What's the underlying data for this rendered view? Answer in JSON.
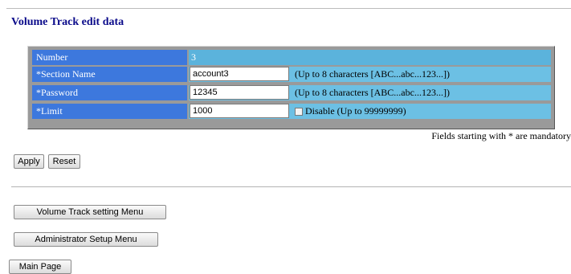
{
  "page": {
    "title": "Volume Track edit data"
  },
  "form": {
    "number": {
      "label": "Number",
      "value": "3"
    },
    "section_name": {
      "label": "*Section Name",
      "value": "account3",
      "hint": "(Up to 8 characters [ABC...abc...123...])"
    },
    "password": {
      "label": "*Password",
      "value": "12345",
      "hint": "(Up to 8 characters [ABC...abc...123...])"
    },
    "limit": {
      "label": "*Limit",
      "value": "1000",
      "disable_label": "Disable (Up to 99999999)",
      "disable_checked": false
    },
    "mandatory_note": "Fields starting with * are mandatory"
  },
  "actions": {
    "apply_label": "Apply",
    "reset_label": "Reset"
  },
  "nav": {
    "volume_track_menu_label": "Volume Track setting Menu",
    "admin_setup_menu_label": "Administrator Setup Menu",
    "main_page_label": "Main Page"
  },
  "colors": {
    "title": "#0a0a8a",
    "label_cell": "#3d78dd",
    "value_cell": "#6cc0e4",
    "panel_frame": "#9a9a9a"
  }
}
